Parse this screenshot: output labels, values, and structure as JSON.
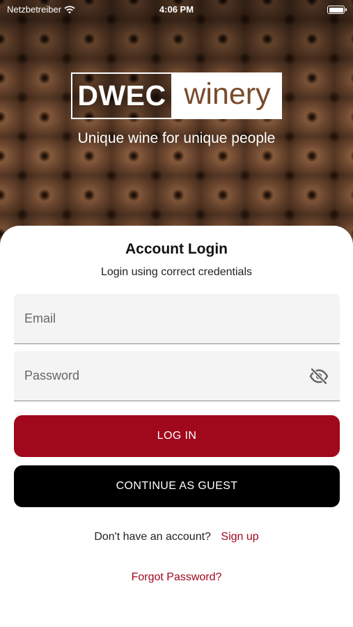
{
  "status_bar": {
    "carrier": "Netzbetreiber",
    "time": "4:06 PM",
    "battery_level": 1.0
  },
  "brand": {
    "logo_left": "DWEC",
    "logo_right": "winery",
    "tagline": "Unique wine for unique people"
  },
  "login": {
    "title": "Account Login",
    "subtitle": "Login using correct credentials",
    "email_placeholder": "Email",
    "email_value": "",
    "password_placeholder": "Password",
    "password_value": "",
    "login_button": "LOG IN",
    "guest_button": "CONTINUE AS GUEST",
    "no_account_text": "Don't have an account?",
    "signup_link": "Sign up",
    "forgot_link": "Forgot Password?"
  },
  "colors": {
    "accent": "#a0081c",
    "guest_button": "#000000",
    "brand_brown": "#7a4a2b"
  },
  "icons": {
    "wifi": "wifi-icon",
    "battery": "battery-icon",
    "password_toggle": "eye-off-icon"
  }
}
